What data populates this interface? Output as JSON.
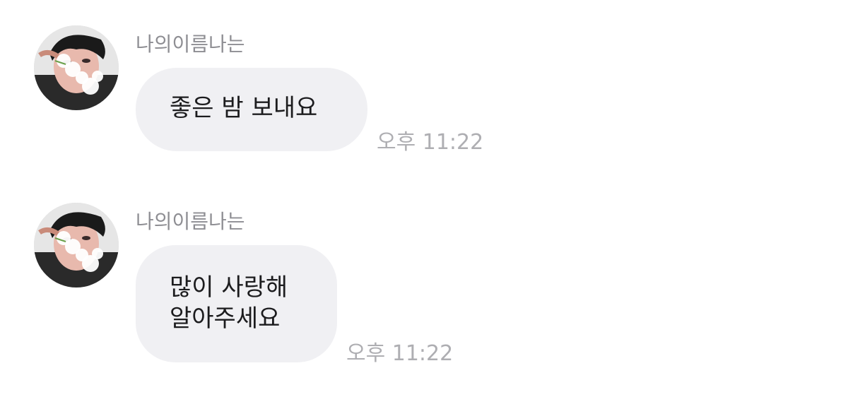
{
  "messages": [
    {
      "sender": "나의이름나는",
      "lines": [
        "좋은 밤 보내요"
      ],
      "time": "오후 11:22"
    },
    {
      "sender": "나의이름나는",
      "lines": [
        "많이 사랑해",
        "알아주세요"
      ],
      "time": "오후 11:22"
    }
  ],
  "colors": {
    "bubble": "#f0f0f3",
    "sender": "#8e8e93",
    "timestamp": "#aeaeb2",
    "text": "#1c1c1e"
  }
}
